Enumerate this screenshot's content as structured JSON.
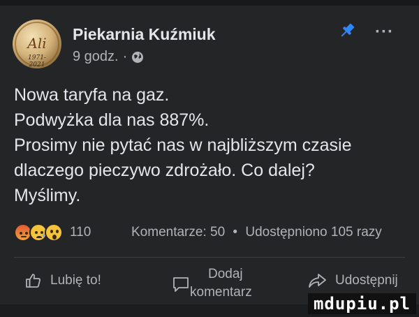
{
  "post": {
    "page_name": "Piekarnia Kuźmiuk",
    "time": "9 godz.",
    "separator": "·",
    "avatar": {
      "script_text": "Ali",
      "years_text": "1971-2021"
    },
    "pin_icon": "pin-icon",
    "more_label": "···",
    "text_lines": [
      "Nowa taryfa na gaz.",
      "Podwyżka dla nas 887%.",
      "Prosimy nie pytać nas w najbliższym czasie",
      "dlaczego pieczywo zdrożało. Co dalej?",
      "Myślimy."
    ]
  },
  "stats": {
    "reaction_icons": [
      "angry-emoji-icon",
      "sad-emoji-icon",
      "wow-emoji-icon"
    ],
    "reaction_count": "110",
    "comments": "Komentarze: 50",
    "dot": "•",
    "shares": "Udostępniono 105 razy"
  },
  "actions": {
    "like": "Lubię to!",
    "comment_line1": "Dodaj",
    "comment_line2": "komentarz",
    "share": "Udostępnij"
  },
  "watermark": "mdupiu.pl",
  "colors": {
    "background": "#242526",
    "text": "#e4e6eb",
    "secondary": "#b0b3b8",
    "pin": "#2d88ff"
  }
}
